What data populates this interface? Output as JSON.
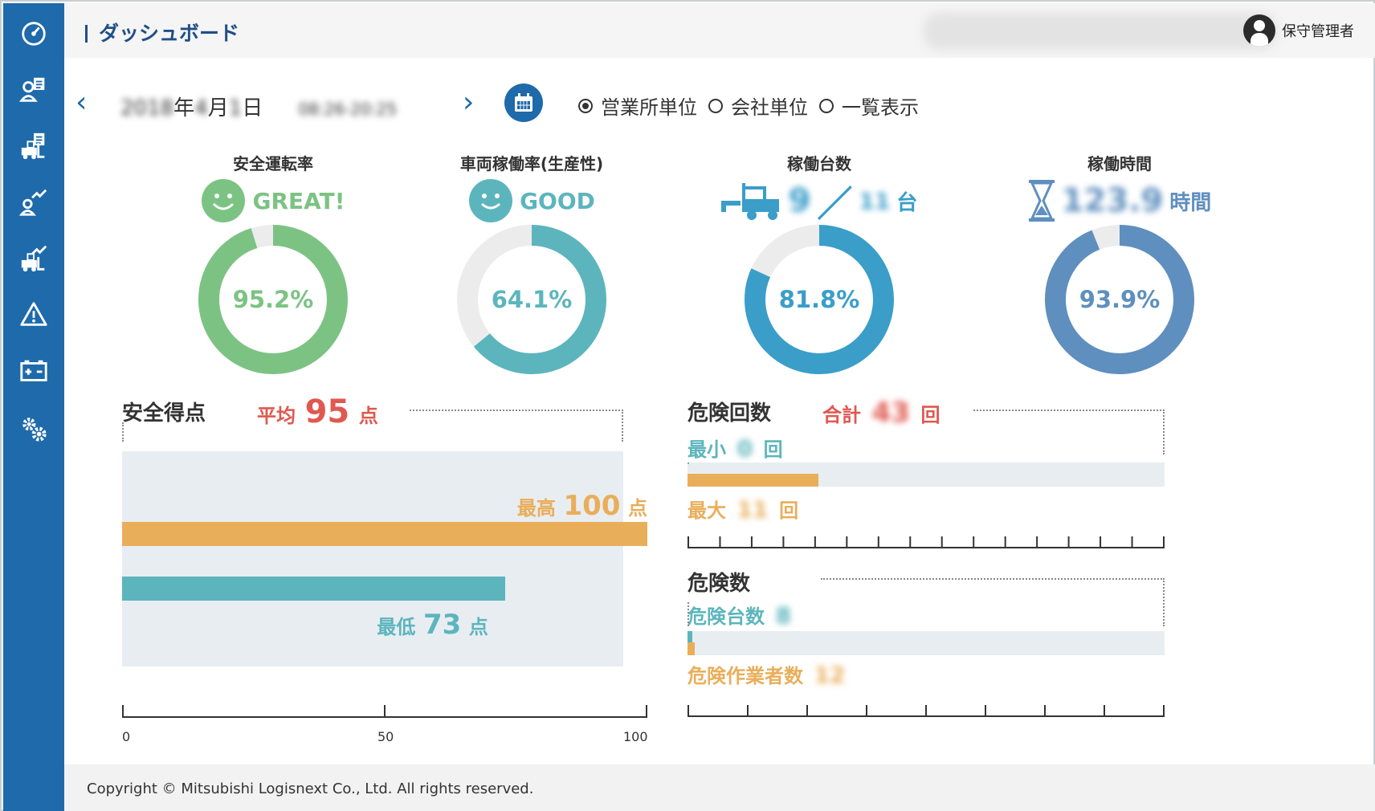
{
  "header": {
    "title": "ダッシュボード",
    "user": "保守管理者"
  },
  "date": {
    "year": "2018",
    "year_unit": "年",
    "month": "4",
    "month_unit": "月",
    "day": "1",
    "day_unit": "日",
    "time_range": "08:26-20:25",
    "prev": "‹",
    "next": "›"
  },
  "view_options": [
    {
      "label": "営業所単位",
      "selected": true
    },
    {
      "label": "会社単位",
      "selected": false
    },
    {
      "label": "一覧表示",
      "selected": false
    }
  ],
  "kpis": {
    "safety": {
      "title": "安全運転率",
      "grade": "GREAT!",
      "value": "95.2%",
      "percent": 95.2,
      "color": "#7cc383"
    },
    "utilization": {
      "title": "車両稼働率(生産性)",
      "grade": "GOOD",
      "value": "64.1%",
      "percent": 64.1,
      "color": "#5cb5bd"
    },
    "units": {
      "title": "稼働台数",
      "active": "9",
      "total": "11",
      "unit": "台",
      "value": "81.8%",
      "percent": 81.8,
      "color": "#3a9ec9"
    },
    "hours": {
      "title": "稼働時間",
      "hours": "123.9",
      "unit": "時間",
      "value": "93.9%",
      "percent": 93.9,
      "color": "#5f8fbe"
    }
  },
  "score": {
    "title": "安全得点",
    "avg_label": "平均",
    "avg_value": "95",
    "unit": "点",
    "max_label": "最高",
    "max_value": "100",
    "max": 100,
    "min_label": "最低",
    "min_value": "73",
    "min": 73,
    "axis": [
      "0",
      "50",
      "100"
    ]
  },
  "danger_count": {
    "title": "危険回数",
    "total_label": "合計",
    "total_value": "43",
    "unit": "回",
    "min_label": "最小",
    "min_value": "0",
    "min": 0,
    "max_label": "最大",
    "max_value": "11",
    "max": 11
  },
  "danger_num": {
    "title": "危険数",
    "units_label": "危険台数",
    "units_value": "8",
    "units": 8,
    "workers_label": "危険作業者数",
    "workers_value": "12",
    "workers": 12
  },
  "footer": {
    "copyright": "Copyright © Mitsubishi Logisnext Co., Ltd. All rights reserved."
  },
  "colors": {
    "sidebar": "#1e6aaa",
    "orange": "#e9ae5a",
    "teal": "#5cb5bd",
    "red": "#e0584f",
    "track": "#e8edf2"
  }
}
